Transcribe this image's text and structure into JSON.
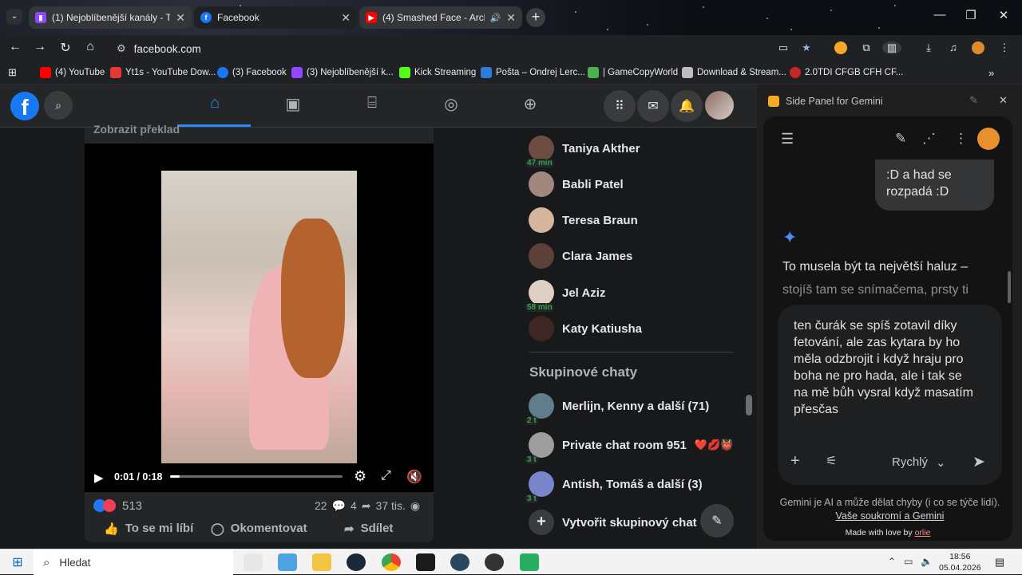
{
  "browser": {
    "tabs": [
      {
        "title": "(1) Nejoblíbenější kanály - Twitch",
        "icon": "twitch-icon"
      },
      {
        "title": "Facebook",
        "icon": "facebook-icon"
      },
      {
        "title": "(4) Smashed Face - Architects",
        "icon": "youtube-icon"
      }
    ],
    "url": "facebook.com",
    "bookmarks": [
      {
        "label": "(4) YouTube",
        "icon": "youtube-icon",
        "color": "#ff0000"
      },
      {
        "label": "Yt1s - YouTube Dow...",
        "icon": "download-icon",
        "color": "#e53935"
      },
      {
        "label": "(3) Facebook",
        "icon": "facebook-icon",
        "color": "#1877f2"
      },
      {
        "label": "(3) Nejoblíbenější k...",
        "icon": "twitch-icon",
        "color": "#9146ff"
      },
      {
        "label": "Kick Streaming",
        "icon": "kick-icon",
        "color": "#53fc18"
      },
      {
        "label": "Pošta – Ondrej Lerc...",
        "icon": "mail-icon",
        "color": "#2f7bd9"
      },
      {
        "label": "| GameCopyWorld",
        "icon": "gamecopy-icon",
        "color": "#4caf50"
      },
      {
        "label": "Download & Stream...",
        "icon": "building-icon",
        "color": "#bdbdbd"
      },
      {
        "label": "2.0TDI CFGB CFH CF...",
        "icon": "gear-icon",
        "color": "#c62828"
      }
    ]
  },
  "facebook": {
    "post_top_text": "Zobrazit překlad",
    "video": {
      "time": "0:01 / 0:18",
      "progress": 0.055
    },
    "reactions_count": "513",
    "comments_count": "22",
    "shares_count": "4",
    "views_count": "37 tis.",
    "actions": {
      "like": "To se mi líbí",
      "comment": "Okomentovat",
      "share": "Sdílet"
    },
    "contacts": [
      {
        "name": "Taniya Akther",
        "badge": "47 min",
        "color": "#6d4c41"
      },
      {
        "name": "Babli Patel",
        "badge": "",
        "color": "#a1887f"
      },
      {
        "name": "Teresa Braun",
        "badge": "",
        "color": "#d7b49e"
      },
      {
        "name": "Clara James",
        "badge": "",
        "color": "#5d4037"
      },
      {
        "name": "Jel Aziz",
        "badge": "58 min",
        "color": "#e0cfc4"
      },
      {
        "name": "Katy Katiusha",
        "badge": "",
        "color": "#3e2723"
      }
    ],
    "group_chats_heading": "Skupinové chaty",
    "group_chats": [
      {
        "name": "Merlijn, Kenny a další (71)",
        "badge": "2 t",
        "emoji": ""
      },
      {
        "name": "Private chat room 951",
        "badge": "3 t",
        "emoji": "❤️💋👹"
      },
      {
        "name": "Antish, Tomáš a další (3)",
        "badge": "3 t",
        "emoji": ""
      }
    ],
    "create_group": "Vytvořit skupinový chat"
  },
  "gemini": {
    "panel_title": "Side Panel for Gemini",
    "user_message": ":D a had se\nrozpadá :D",
    "reply_line1": "To musela být ta největší haluz –",
    "reply_line2": "stojíš tam se snímačema, prsty ti",
    "input_text": "ten čurák se spíš zotavil díky fetování, ale zas kytara by ho měla odzbrojit i když hraju pro boha ne pro hada, ale i tak se na mě bůh vysral když masatím přesčas",
    "model": "Rychlý",
    "disclaimer": "Gemini je AI a může dělat chyby (i co se týče lidí).",
    "privacy_link": "Vaše soukromí a Gemini",
    "made_with": "Made with love by",
    "author": "orlie"
  },
  "taskbar": {
    "search_placeholder": "Hledat",
    "time": "18:56",
    "date": "05.04.2026"
  }
}
